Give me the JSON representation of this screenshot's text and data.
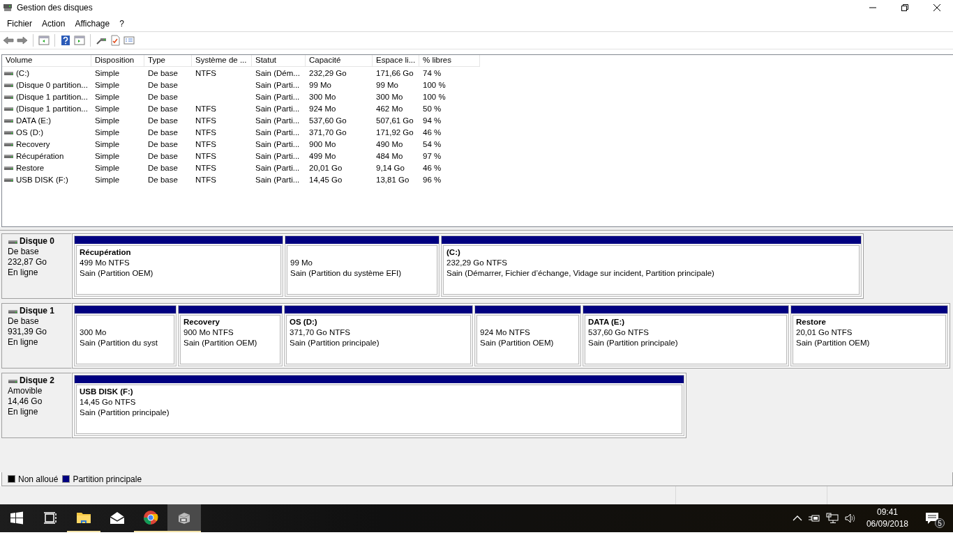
{
  "window": {
    "title": "Gestion des disques"
  },
  "menu": [
    "Fichier",
    "Action",
    "Affichage",
    "?"
  ],
  "table": {
    "columns": [
      "Volume",
      "Disposition",
      "Type",
      "Système de ...",
      "Statut",
      "Capacité",
      "Espace li...",
      "% libres"
    ],
    "rows": [
      {
        "cells": [
          "(C:)",
          "Simple",
          "De base",
          "NTFS",
          "Sain (Dém...",
          "232,29 Go",
          "171,66 Go",
          "74 %"
        ]
      },
      {
        "cells": [
          "(Disque 0 partition...",
          "Simple",
          "De base",
          "",
          "Sain (Parti...",
          "99 Mo",
          "99 Mo",
          "100 %"
        ]
      },
      {
        "cells": [
          "(Disque 1 partition...",
          "Simple",
          "De base",
          "",
          "Sain (Parti...",
          "300 Mo",
          "300 Mo",
          "100 %"
        ]
      },
      {
        "cells": [
          "(Disque 1 partition...",
          "Simple",
          "De base",
          "NTFS",
          "Sain (Parti...",
          "924 Mo",
          "462 Mo",
          "50 %"
        ]
      },
      {
        "cells": [
          "DATA (E:)",
          "Simple",
          "De base",
          "NTFS",
          "Sain (Parti...",
          "537,60 Go",
          "507,61 Go",
          "94 %"
        ]
      },
      {
        "cells": [
          "OS (D:)",
          "Simple",
          "De base",
          "NTFS",
          "Sain (Parti...",
          "371,70 Go",
          "171,92 Go",
          "46 %"
        ]
      },
      {
        "cells": [
          "Recovery",
          "Simple",
          "De base",
          "NTFS",
          "Sain (Parti...",
          "900 Mo",
          "490 Mo",
          "54 %"
        ]
      },
      {
        "cells": [
          "Récupération",
          "Simple",
          "De base",
          "NTFS",
          "Sain (Parti...",
          "499 Mo",
          "484 Mo",
          "97 %"
        ]
      },
      {
        "cells": [
          "Restore",
          "Simple",
          "De base",
          "NTFS",
          "Sain (Parti...",
          "20,01 Go",
          "9,14 Go",
          "46 %"
        ]
      },
      {
        "cells": [
          "USB DISK (F:)",
          "Simple",
          "De base",
          "NTFS",
          "Sain (Parti...",
          "14,45 Go",
          "13,81 Go",
          "96 %"
        ]
      }
    ]
  },
  "disks": [
    {
      "name": "Disque 0",
      "type": "De base",
      "size": "232,87 Go",
      "status": "En ligne",
      "partitions": [
        {
          "kind": "primary",
          "name": "Récupération",
          "size": "499 Mo NTFS",
          "status": "Sain (Partition OEM)"
        },
        {
          "kind": "primary",
          "size": "99 Mo",
          "status": "Sain (Partition du système EFI)"
        },
        {
          "kind": "primary",
          "name": "(C:)",
          "size": "232,29 Go NTFS",
          "status": "Sain (Démarrer, Fichier d’échange, Vidage sur incident, Partition principale)"
        }
      ]
    },
    {
      "name": "Disque 1",
      "type": "De base",
      "size": "931,39 Go",
      "status": "En ligne",
      "partitions": [
        {
          "kind": "primary",
          "size": "300 Mo",
          "status": "Sain (Partition du syst"
        },
        {
          "kind": "primary",
          "name": "Recovery",
          "size": "900 Mo NTFS",
          "status": "Sain (Partition OEM)"
        },
        {
          "kind": "primary",
          "name": "OS  (D:)",
          "size": "371,70 Go NTFS",
          "status": "Sain (Partition principale)"
        },
        {
          "kind": "primary",
          "size": "924 Mo NTFS",
          "status": "Sain (Partition OEM)"
        },
        {
          "kind": "primary",
          "name": "DATA  (E:)",
          "size": "537,60 Go NTFS",
          "status": "Sain (Partition principale)"
        },
        {
          "kind": "primary",
          "name": "Restore",
          "size": "20,01 Go NTFS",
          "status": "Sain (Partition OEM)"
        }
      ]
    },
    {
      "name": "Disque 2",
      "type": "Amovible",
      "size": "14,46 Go",
      "status": "En ligne",
      "partitions": [
        {
          "kind": "primary",
          "name": "USB DISK  (F:)",
          "size": "14,45 Go NTFS",
          "status": "Sain (Partition principale)"
        }
      ]
    }
  ],
  "legend": [
    {
      "kind": "unallocated",
      "label": "Non alloué",
      "color": "#000000"
    },
    {
      "kind": "primary",
      "label": "Partition principale",
      "color": "#000080"
    }
  ],
  "taskbar": {
    "apps": [
      {
        "kind": "start",
        "running": false,
        "selected": false
      },
      {
        "kind": "taskview",
        "running": false,
        "selected": false
      },
      {
        "kind": "explorer",
        "running": true,
        "selected": false
      },
      {
        "kind": "mail",
        "running": false,
        "selected": false
      },
      {
        "kind": "chrome",
        "running": true,
        "selected": false
      },
      {
        "kind": "diskmgmt",
        "running": true,
        "selected": true
      }
    ],
    "time": "09:41",
    "date": "06/09/2018",
    "notifications": "5"
  }
}
